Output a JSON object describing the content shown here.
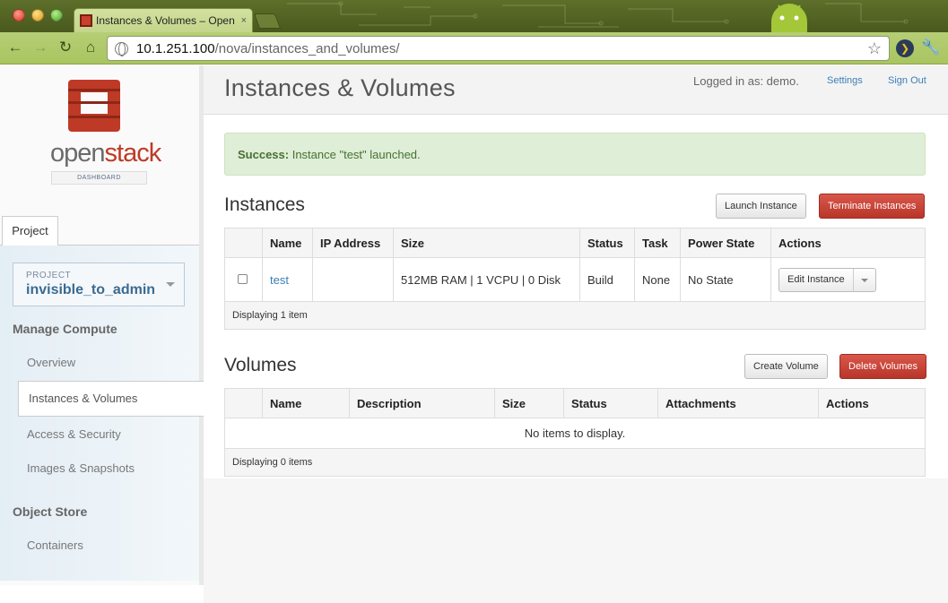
{
  "browser": {
    "tab_title": "Instances & Volumes – Open",
    "tab_close": "×",
    "url_host": "10.1.251.100",
    "url_path": "/nova/instances_and_volumes/"
  },
  "sidebar": {
    "logo_open": "open",
    "logo_stack": "stack",
    "logo_dashboard": "DASHBOARD",
    "project_tab": "Project",
    "project_label": "PROJECT",
    "project_name": "invisible_to_admin",
    "manage_compute": "Manage Compute",
    "items": [
      {
        "label": "Overview"
      },
      {
        "label": "Instances & Volumes"
      },
      {
        "label": "Access & Security"
      },
      {
        "label": "Images & Snapshots"
      }
    ],
    "object_store": "Object Store",
    "containers": "Containers"
  },
  "header": {
    "title": "Instances & Volumes",
    "logged_in": "Logged in as: demo.",
    "settings": "Settings",
    "sign_out": "Sign Out"
  },
  "alert": {
    "strong": "Success:",
    "message": " Instance \"test\" launched."
  },
  "instances": {
    "title": "Instances",
    "launch_button": "Launch Instance",
    "terminate_button": "Terminate Instances",
    "columns": [
      "Name",
      "IP Address",
      "Size",
      "Status",
      "Task",
      "Power State",
      "Actions"
    ],
    "rows": [
      {
        "name": "test",
        "ip": "",
        "size": "512MB RAM | 1 VCPU | 0 Disk",
        "status": "Build",
        "task": "None",
        "power": "No State",
        "action": "Edit Instance"
      }
    ],
    "footer": "Displaying 1 item"
  },
  "volumes": {
    "title": "Volumes",
    "create_button": "Create Volume",
    "delete_button": "Delete Volumes",
    "columns": [
      "Name",
      "Description",
      "Size",
      "Status",
      "Attachments",
      "Actions"
    ],
    "empty": "No items to display.",
    "footer": "Displaying 0 items"
  },
  "colors": {
    "brand_red": "#be3a26",
    "link_blue": "#3a7fb7",
    "success_bg": "#dfeed6",
    "danger": "#b8352a"
  }
}
